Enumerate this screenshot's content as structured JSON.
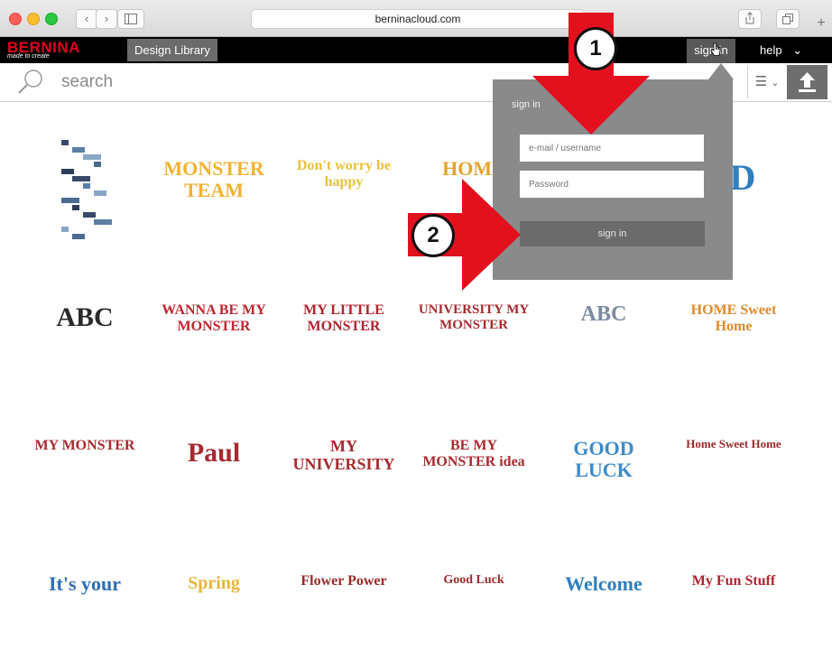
{
  "browser": {
    "url": "berninacloud.com"
  },
  "site": {
    "logo": "BERNINA",
    "logo_tagline": "made to create",
    "design_library": "Design Library",
    "signin": "sign in",
    "help": "help"
  },
  "search": {
    "placeholder": "search"
  },
  "signin_panel": {
    "title": "sign in",
    "email_placeholder": "e-mail / username",
    "password_placeholder": "Password",
    "button": "sign in"
  },
  "annotations": {
    "step1": "1",
    "step2": "2"
  },
  "designs": [
    {
      "text": ""
    },
    {
      "text": "MONSTER TEAM",
      "color": "#f2b233"
    },
    {
      "text": "Don't worry be happy",
      "color": "#e8c23a"
    },
    {
      "text": "HOME",
      "color": "#e2a52e"
    },
    {
      "text": "",
      "color": "#ffffff"
    },
    {
      "text": "3D",
      "color": "#2f7fbf"
    },
    {
      "text": "ABC",
      "color": "#2a2a2a"
    },
    {
      "text": "WANNA BE MY MONSTER",
      "color": "#c0262f"
    },
    {
      "text": "MY LITTLE MONSTER",
      "color": "#b02430"
    },
    {
      "text": "UNIVERSITY MY MONSTER",
      "color": "#a62b30"
    },
    {
      "text": "ABC",
      "color": "#7c8aa0"
    },
    {
      "text": "HOME Sweet Home",
      "color": "#e0892a"
    },
    {
      "text": "MY MONSTER",
      "color": "#a62b30"
    },
    {
      "text": "Paul",
      "color": "#a62b30"
    },
    {
      "text": "MY UNIVERSITY",
      "color": "#a62b30"
    },
    {
      "text": "BE MY MONSTER idea",
      "color": "#a62b30"
    },
    {
      "text": "GOOD LUCK",
      "color": "#3f8ac9"
    },
    {
      "text": "Home Sweet Home",
      "color": "#9a2a2a"
    },
    {
      "text": "It's your",
      "color": "#2f6fb3"
    },
    {
      "text": "Spring",
      "color": "#e8b73a"
    },
    {
      "text": "Flower Power",
      "color": "#9a2a2a"
    },
    {
      "text": "Good Luck",
      "color": "#9a2a2a"
    },
    {
      "text": "Welcome",
      "color": "#2f7fbf"
    },
    {
      "text": "My Fun Stuff",
      "color": "#b02430"
    }
  ]
}
